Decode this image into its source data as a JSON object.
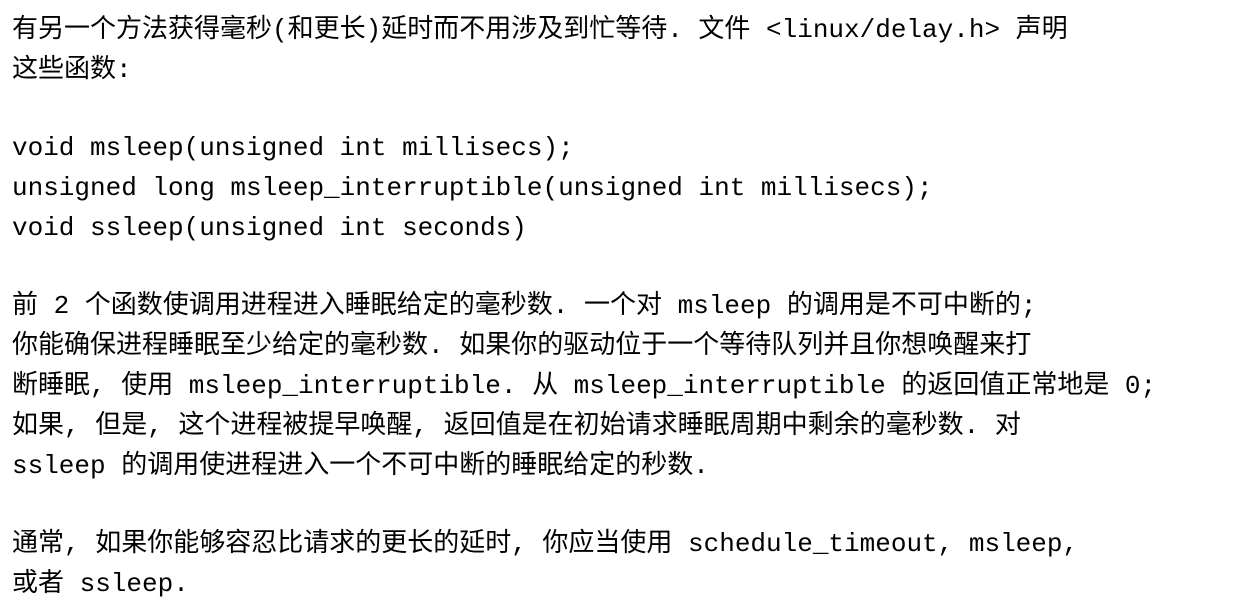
{
  "paragraphs": [
    {
      "lines": [
        "有另一个方法获得毫秒(和更长)延时而不用涉及到忙等待. 文件 <linux/delay.h> 声明",
        "这些函数:"
      ]
    },
    {
      "lines": [
        "void msleep(unsigned int millisecs);",
        "unsigned long msleep_interruptible(unsigned int millisecs);",
        "void ssleep(unsigned int seconds)"
      ]
    },
    {
      "lines": [
        "前 2 个函数使调用进程进入睡眠给定的毫秒数. 一个对 msleep 的调用是不可中断的;",
        "你能确保进程睡眠至少给定的毫秒数. 如果你的驱动位于一个等待队列并且你想唤醒来打",
        "断睡眠, 使用 msleep_interruptible. 从 msleep_interruptible 的返回值正常地是 0;",
        "如果, 但是, 这个进程被提早唤醒, 返回值是在初始请求睡眠周期中剩余的毫秒数. 对",
        "ssleep 的调用使进程进入一个不可中断的睡眠给定的秒数."
      ]
    },
    {
      "lines": [
        "通常, 如果你能够容忍比请求的更长的延时, 你应当使用 schedule_timeout, msleep,",
        "或者 ssleep."
      ]
    }
  ]
}
